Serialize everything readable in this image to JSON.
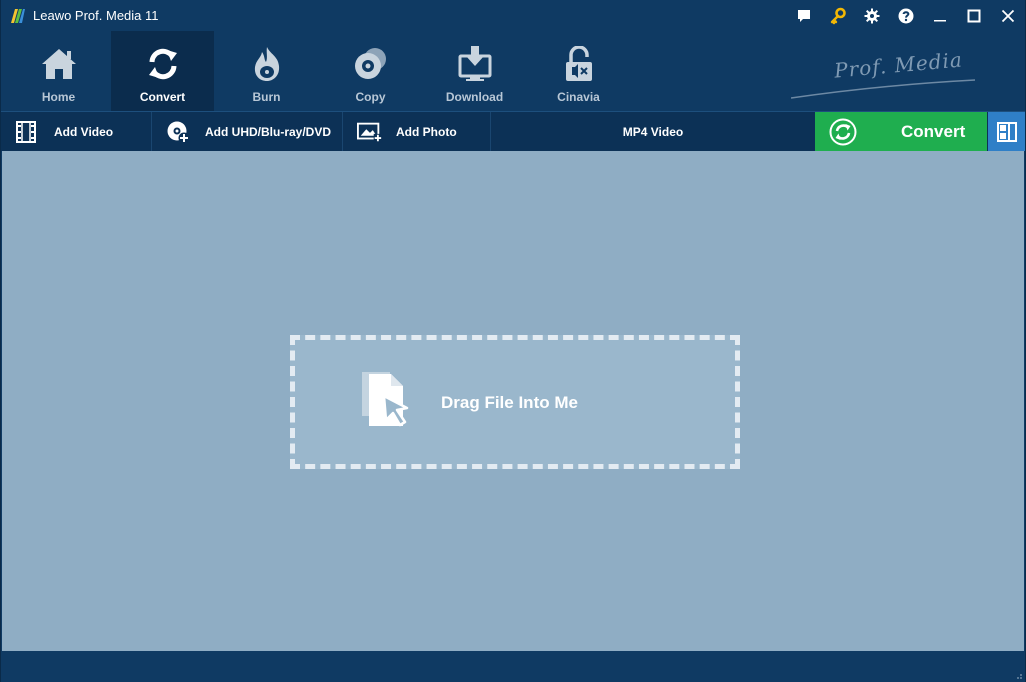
{
  "window": {
    "title": "Leawo Prof. Media 11",
    "title_icons": [
      "feedback-icon",
      "register-key-icon",
      "settings-icon",
      "help-icon",
      "minimize-icon",
      "maximize-icon",
      "close-icon"
    ]
  },
  "nav": {
    "items": [
      {
        "label": "Home",
        "icon": "home-icon"
      },
      {
        "label": "Convert",
        "icon": "convert-icon",
        "active": true
      },
      {
        "label": "Burn",
        "icon": "burn-icon"
      },
      {
        "label": "Copy",
        "icon": "copy-disc-icon"
      },
      {
        "label": "Download",
        "icon": "download-icon"
      },
      {
        "label": "Cinavia",
        "icon": "cinavia-unlock-icon"
      }
    ],
    "brand": "Prof. Media"
  },
  "toolbar": {
    "add_video": "Add Video",
    "add_disc": "Add UHD/Blu-ray/DVD",
    "add_photo": "Add Photo",
    "format": "MP4 Video",
    "convert": "Convert"
  },
  "dropzone": {
    "text": "Drag File Into Me"
  },
  "colors": {
    "window_bg": "#0f3a63",
    "active_tab": "#0b2c4d",
    "content_bg": "#8fadc4",
    "convert_green": "#1fae4f",
    "panel_toggle_blue": "#2f7fc7"
  }
}
